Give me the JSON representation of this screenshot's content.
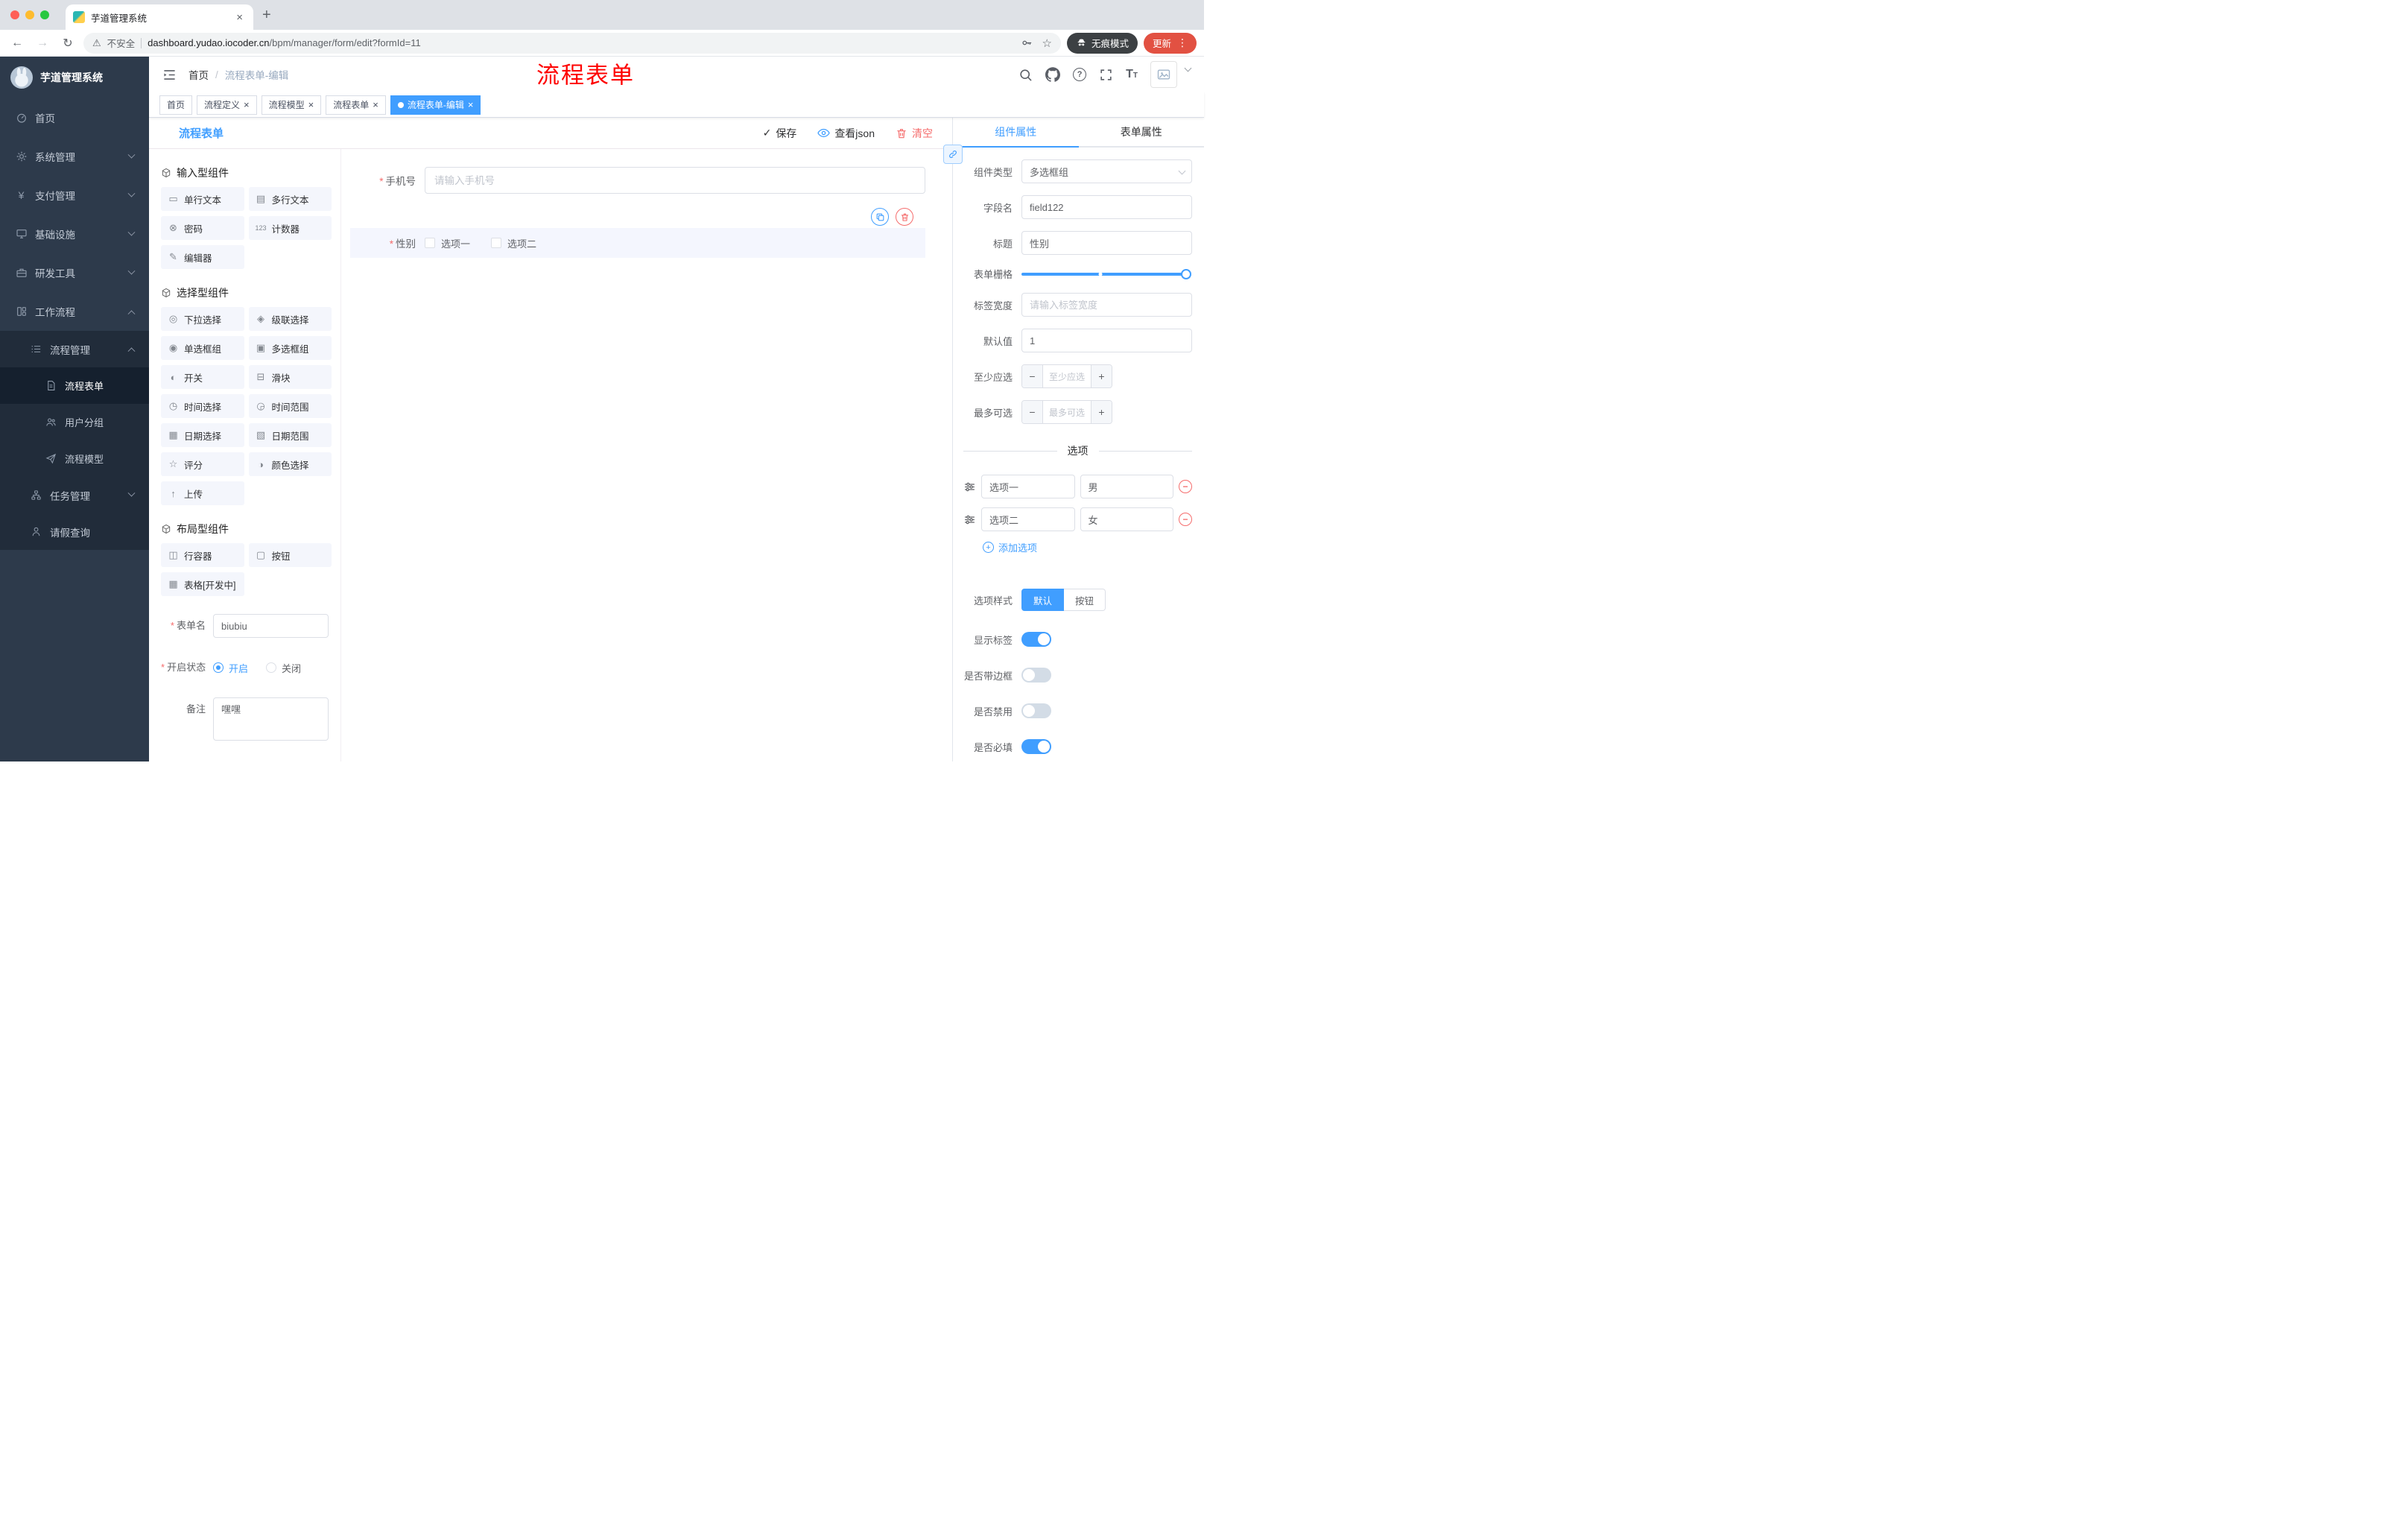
{
  "icons": {
    "back": "←",
    "forward": "→",
    "reload": "↻",
    "warning": "⚠",
    "star": "☆",
    "dots": "⋮",
    "close": "×",
    "plus": "+",
    "check": "✓",
    "minus": "−"
  },
  "browser": {
    "tab": {
      "title": "芋道管理系统"
    },
    "address": {
      "security_label": "不安全",
      "url_domain": "dashboard.yudao.iocoder.cn",
      "url_path": "/bpm/manager/form/edit?formId=11"
    },
    "incognito_label": "无痕模式",
    "update_label": "更新"
  },
  "sidebar": {
    "logo_title": "芋道管理系统",
    "items": [
      {
        "label": "首页"
      },
      {
        "label": "系统管理"
      },
      {
        "label": "支付管理"
      },
      {
        "label": "基础设施"
      },
      {
        "label": "研发工具"
      },
      {
        "label": "工作流程"
      },
      {
        "label": "流程管理"
      },
      {
        "label": "流程表单"
      },
      {
        "label": "用户分组"
      },
      {
        "label": "流程模型"
      },
      {
        "label": "任务管理"
      },
      {
        "label": "请假查询"
      }
    ]
  },
  "header": {
    "breadcrumb_home": "首页",
    "breadcrumb_current": "流程表单-编辑",
    "annotation": "流程表单"
  },
  "tags": [
    {
      "label": "首页"
    },
    {
      "label": "流程定义"
    },
    {
      "label": "流程模型"
    },
    {
      "label": "流程表单"
    },
    {
      "label": "流程表单-编辑"
    }
  ],
  "designer": {
    "title": "流程表单",
    "actions": {
      "save": "保存",
      "view_json": "查看json",
      "clear": "清空"
    },
    "groups": [
      {
        "title": "输入型组件",
        "items": [
          {
            "icon": "▭",
            "label": "单行文本"
          },
          {
            "icon": "▤",
            "label": "多行文本"
          },
          {
            "icon": "⊗",
            "label": "密码"
          },
          {
            "icon": "123",
            "label": "计数器"
          },
          {
            "icon": "✎",
            "label": "编辑器"
          }
        ]
      },
      {
        "title": "选择型组件",
        "items": [
          {
            "icon": "◎",
            "label": "下拉选择"
          },
          {
            "icon": "◈",
            "label": "级联选择"
          },
          {
            "icon": "◉",
            "label": "单选框组"
          },
          {
            "icon": "▣",
            "label": "多选框组"
          },
          {
            "icon": "◐",
            "label": "开关"
          },
          {
            "icon": "⊟",
            "label": "滑块"
          },
          {
            "icon": "◷",
            "label": "时间选择"
          },
          {
            "icon": "◶",
            "label": "时间范围"
          },
          {
            "icon": "▦",
            "label": "日期选择"
          },
          {
            "icon": "▧",
            "label": "日期范围"
          },
          {
            "icon": "☆",
            "label": "评分"
          },
          {
            "icon": "◑",
            "label": "颜色选择"
          },
          {
            "icon": "↑",
            "label": "上传"
          }
        ]
      },
      {
        "title": "布局型组件",
        "items": [
          {
            "icon": "◫",
            "label": "行容器"
          },
          {
            "icon": "▢",
            "label": "按钮"
          },
          {
            "icon": "▦",
            "label": "表格[开发中]"
          }
        ]
      }
    ],
    "meta": {
      "form_name_label": "表单名",
      "form_name_value": "biubiu",
      "status_label": "开启状态",
      "status_on": "开启",
      "status_off": "关闭",
      "remark_label": "备注",
      "remark_value": "嘿嘿"
    },
    "canvas": {
      "phone_label": "手机号",
      "phone_placeholder": "请输入手机号",
      "gender_label": "性别",
      "gender_option1": "选项一",
      "gender_option2": "选项二"
    }
  },
  "props": {
    "tab_component": "组件属性",
    "tab_form": "表单属性",
    "type_label": "组件类型",
    "type_value": "多选框组",
    "field_label": "字段名",
    "field_value": "field122",
    "title_label": "标题",
    "title_value": "性别",
    "grid_label": "表单栅格",
    "width_label": "标签宽度",
    "width_placeholder": "请输入标签宽度",
    "default_label": "默认值",
    "default_value": "1",
    "min_label": "至少应选",
    "min_placeholder": "至少应选",
    "max_label": "最多可选",
    "max_placeholder": "最多可选",
    "options_title": "选项",
    "options": [
      {
        "label": "选项一",
        "value": "男"
      },
      {
        "label": "选项二",
        "value": "女"
      }
    ],
    "add_option": "添加选项",
    "style_label": "选项样式",
    "style_default": "默认",
    "style_button": "按钮",
    "toggle_show_label": "显示标签",
    "toggle_border": "是否带边框",
    "toggle_disabled": "是否禁用",
    "toggle_required": "是否必填"
  }
}
